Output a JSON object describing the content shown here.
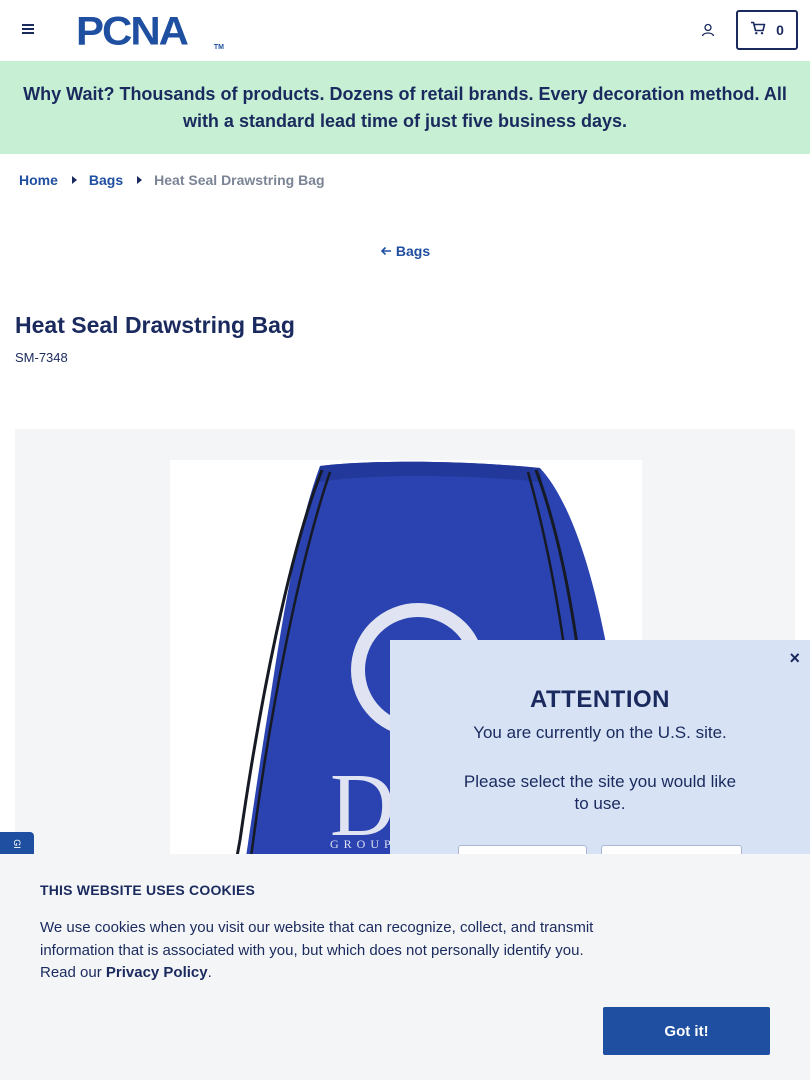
{
  "header": {
    "logo_text": "PCNA",
    "logo_tm": "TM",
    "cart_count": "0"
  },
  "promo": {
    "text": "Why Wait? Thousands of products. Dozens of retail brands. Every decoration method. All with a standard lead time of just five business days."
  },
  "breadcrumb": {
    "items": [
      "Home",
      "Bags"
    ],
    "current": "Heat Seal Drawstring Bag"
  },
  "back_link": {
    "label": "Bags"
  },
  "product": {
    "title": "Heat Seal Drawstring Bag",
    "sku": "SM-7348",
    "image_label": "Bag image",
    "bag_color": "#2a43b0",
    "logo_text": "D",
    "logo_subtext": "GROUP"
  },
  "side_tab": {
    "label": "GI"
  },
  "attention": {
    "title": "ATTENTION",
    "line1": "You are currently on the U.S. site.",
    "line2": "Please select the site you would like to use.",
    "close_label": "×"
  },
  "cookie": {
    "title": "THIS WEBSITE USES COOKIES",
    "text_before": "We use cookies when you visit our website that can recognize, collect, and transmit information that is associated with you, but which does not personally identify you. Read our ",
    "link": "Privacy Policy",
    "text_after": ".",
    "button": "Got it!"
  },
  "colors": {
    "navy": "#1a2a5e",
    "brand_blue": "#1f4fa0",
    "promo_bg": "#c6efd3",
    "attention_bg": "#d7e3f5",
    "cookie_bg": "#f4f5f6"
  },
  "icons": {
    "menu": "hamburger-menu-icon",
    "account": "user-icon",
    "cart": "shopping-cart-icon",
    "back": "arrow-left-icon",
    "close": "close-icon"
  }
}
